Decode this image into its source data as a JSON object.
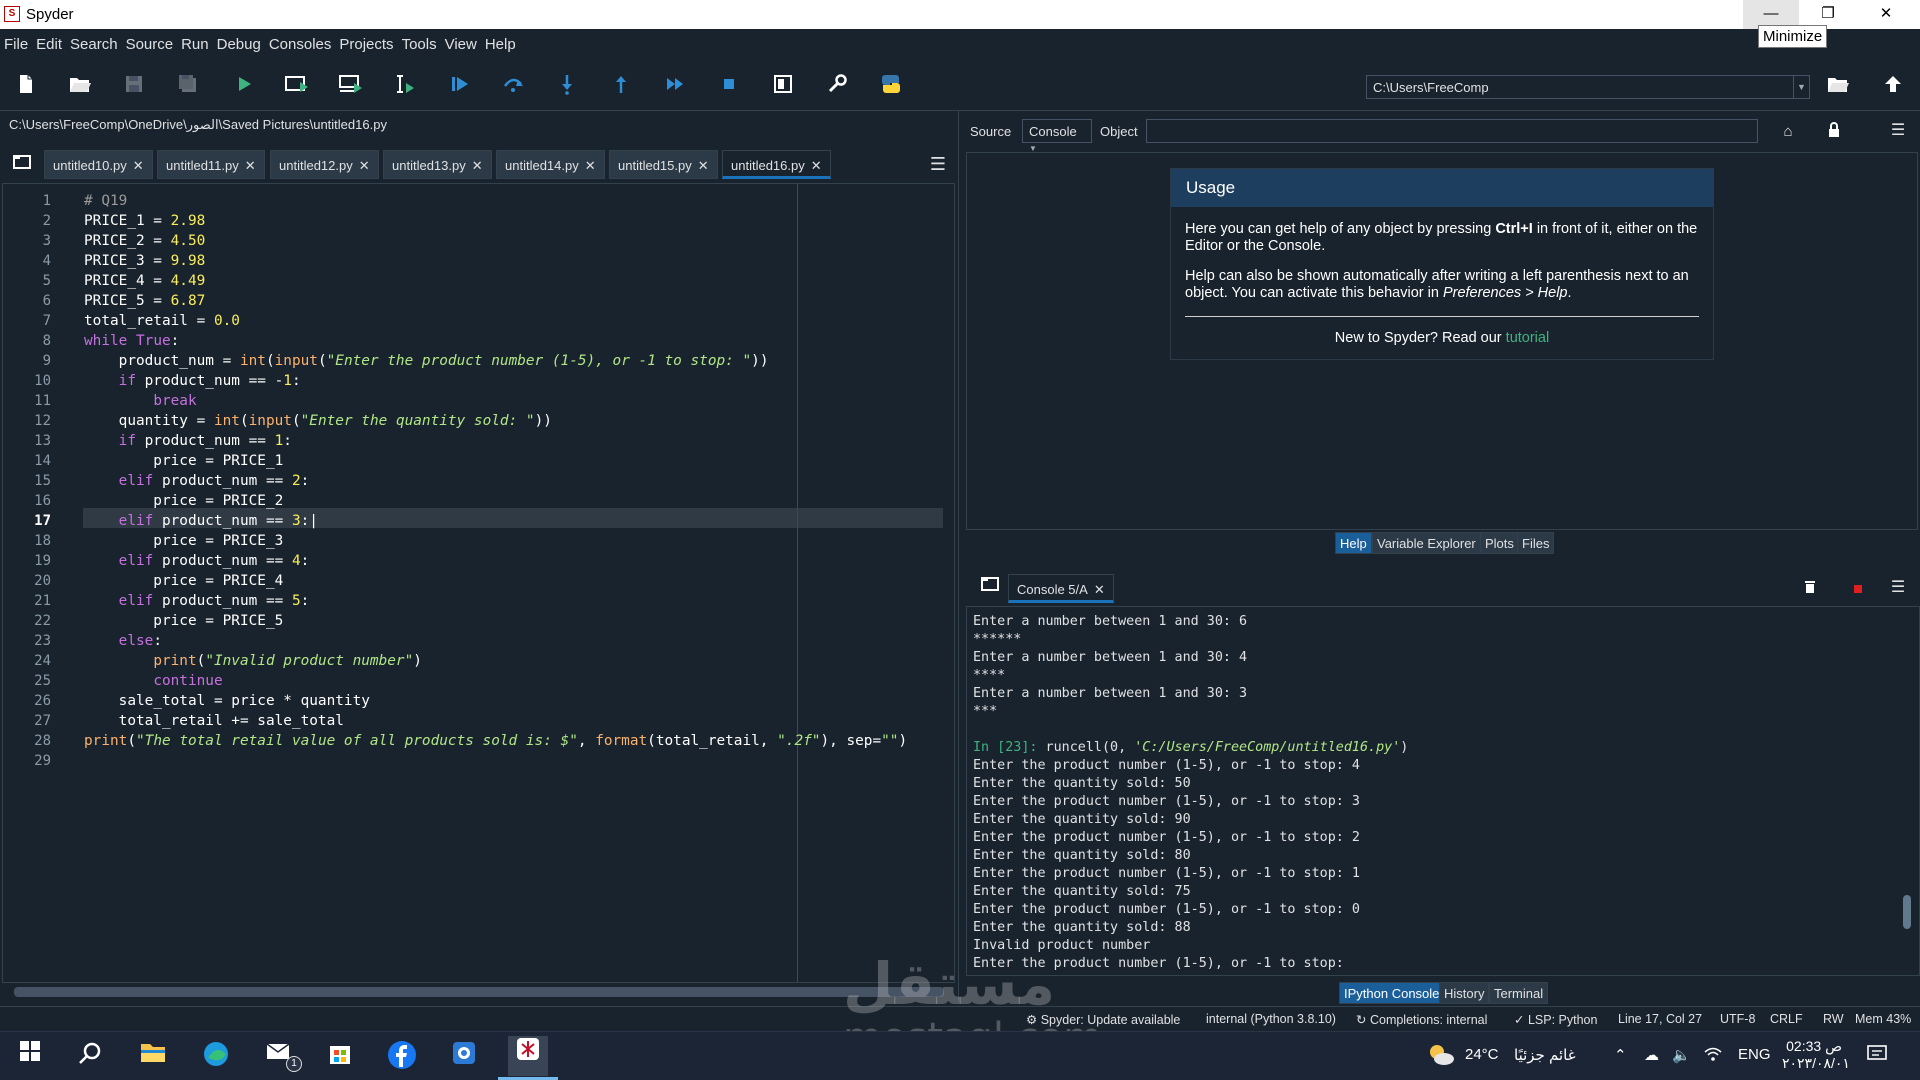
{
  "window": {
    "title": "Spyder",
    "minimize_symbol": "—",
    "maximize_symbol": "❐",
    "close_symbol": "✕",
    "tooltip": "Minimize"
  },
  "menu": [
    "File",
    "Edit",
    "Search",
    "Source",
    "Run",
    "Debug",
    "Consoles",
    "Projects",
    "Tools",
    "View",
    "Help"
  ],
  "toolbar": {
    "icons": [
      "new-file-icon",
      "open-file-icon",
      "save-icon",
      "save-all-icon",
      "run-icon",
      "run-cell-icon",
      "run-cell-advance-icon",
      "run-selection-icon",
      "debug-icon",
      "step-over-icon",
      "step-into-icon",
      "step-return-icon",
      "continue-icon",
      "stop-icon",
      "maximize-pane-icon",
      "preferences-icon",
      "python-path-icon"
    ],
    "working_dir": "C:\\Users\\FreeComp"
  },
  "editor": {
    "file_path": "C:\\Users\\FreeComp\\OneDrive\\الصور\\Saved Pictures\\untitled16.py",
    "tabs": [
      "untitled10.py",
      "untitled11.py",
      "untitled12.py",
      "untitled13.py",
      "untitled14.py",
      "untitled15.py",
      "untitled16.py"
    ],
    "active_tab": "untitled16.py",
    "current_line": 17,
    "line_numbers": [
      "1",
      "2",
      "3",
      "4",
      "5",
      "6",
      "7",
      "8",
      "9",
      "10",
      "11",
      "12",
      "13",
      "14",
      "15",
      "16",
      "17",
      "18",
      "19",
      "20",
      "21",
      "22",
      "23",
      "24",
      "25",
      "26",
      "27",
      "28",
      "29"
    ]
  },
  "help": {
    "source_label": "Source",
    "source_value": "Console",
    "object_label": "Object",
    "object_value": "",
    "usage_title": "Usage",
    "usage_p1_pre": "Here you can get help of any object by pressing ",
    "usage_p1_key": "Ctrl+I",
    "usage_p1_post": " in front of it, either on the Editor or the Console.",
    "usage_p2_pre": "Help can also be shown automatically after writing a left parenthesis next to an object. You can activate this behavior in ",
    "usage_p2_em": "Preferences > Help",
    "usage_p2_post": ".",
    "usage_p3_pre": "New to Spyder? Read our ",
    "usage_p3_link": "tutorial",
    "pane_tabs": [
      "Help",
      "Variable Explorer",
      "Plots",
      "Files"
    ],
    "active_pane_tab": "Help"
  },
  "console": {
    "tab": "Console 5/A",
    "prompt": "In [23]:",
    "prompt_code": " runcell(0, 'C:/Users/FreeComp/untitled16.py')",
    "lines_before": [
      "Enter a number between 1 and 30: 6",
      "******",
      "Enter a number between 1 and 30: 4",
      "****",
      "Enter a number between 1 and 30: 3",
      "***",
      ""
    ],
    "lines_after": [
      "Enter the product number (1-5), or -1 to stop: 4",
      "Enter the quantity sold: 50",
      "Enter the product number (1-5), or -1 to stop: 3",
      "Enter the quantity sold: 90",
      "Enter the product number (1-5), or -1 to stop: 2",
      "Enter the quantity sold: 80",
      "Enter the product number (1-5), or -1 to stop: 1",
      "Enter the quantity sold: 75",
      "Enter the product number (1-5), or -1 to stop: 0",
      "Enter the quantity sold: 88",
      "Invalid product number",
      "Enter the product number (1-5), or -1 to stop:"
    ],
    "pane_tabs": [
      "IPython Console",
      "History",
      "Terminal"
    ],
    "active_pane_tab": "IPython Console"
  },
  "statusbar": {
    "update": "Spyder: Update available",
    "interpreter": "internal (Python 3.8.10)",
    "completions": "Completions: internal",
    "lsp": "LSP: Python",
    "position": "Line 17, Col 27",
    "encoding": "UTF-8",
    "eol": "CRLF",
    "rw": "RW",
    "mem": "Mem 43%"
  },
  "taskbar": {
    "weather_temp": "24°C",
    "weather_text": "غائم جزئيًا",
    "language": "ENG",
    "time": "02:33 ص",
    "date": "٢٠٢٣/٠٨/٠١",
    "mail_badge": "1"
  },
  "watermark": {
    "arabic": "مستقل",
    "latin": "mostaql.com"
  },
  "colors": {
    "background": "#19232d",
    "accent": "#1a72bb",
    "prompt": "#3fb37f"
  }
}
